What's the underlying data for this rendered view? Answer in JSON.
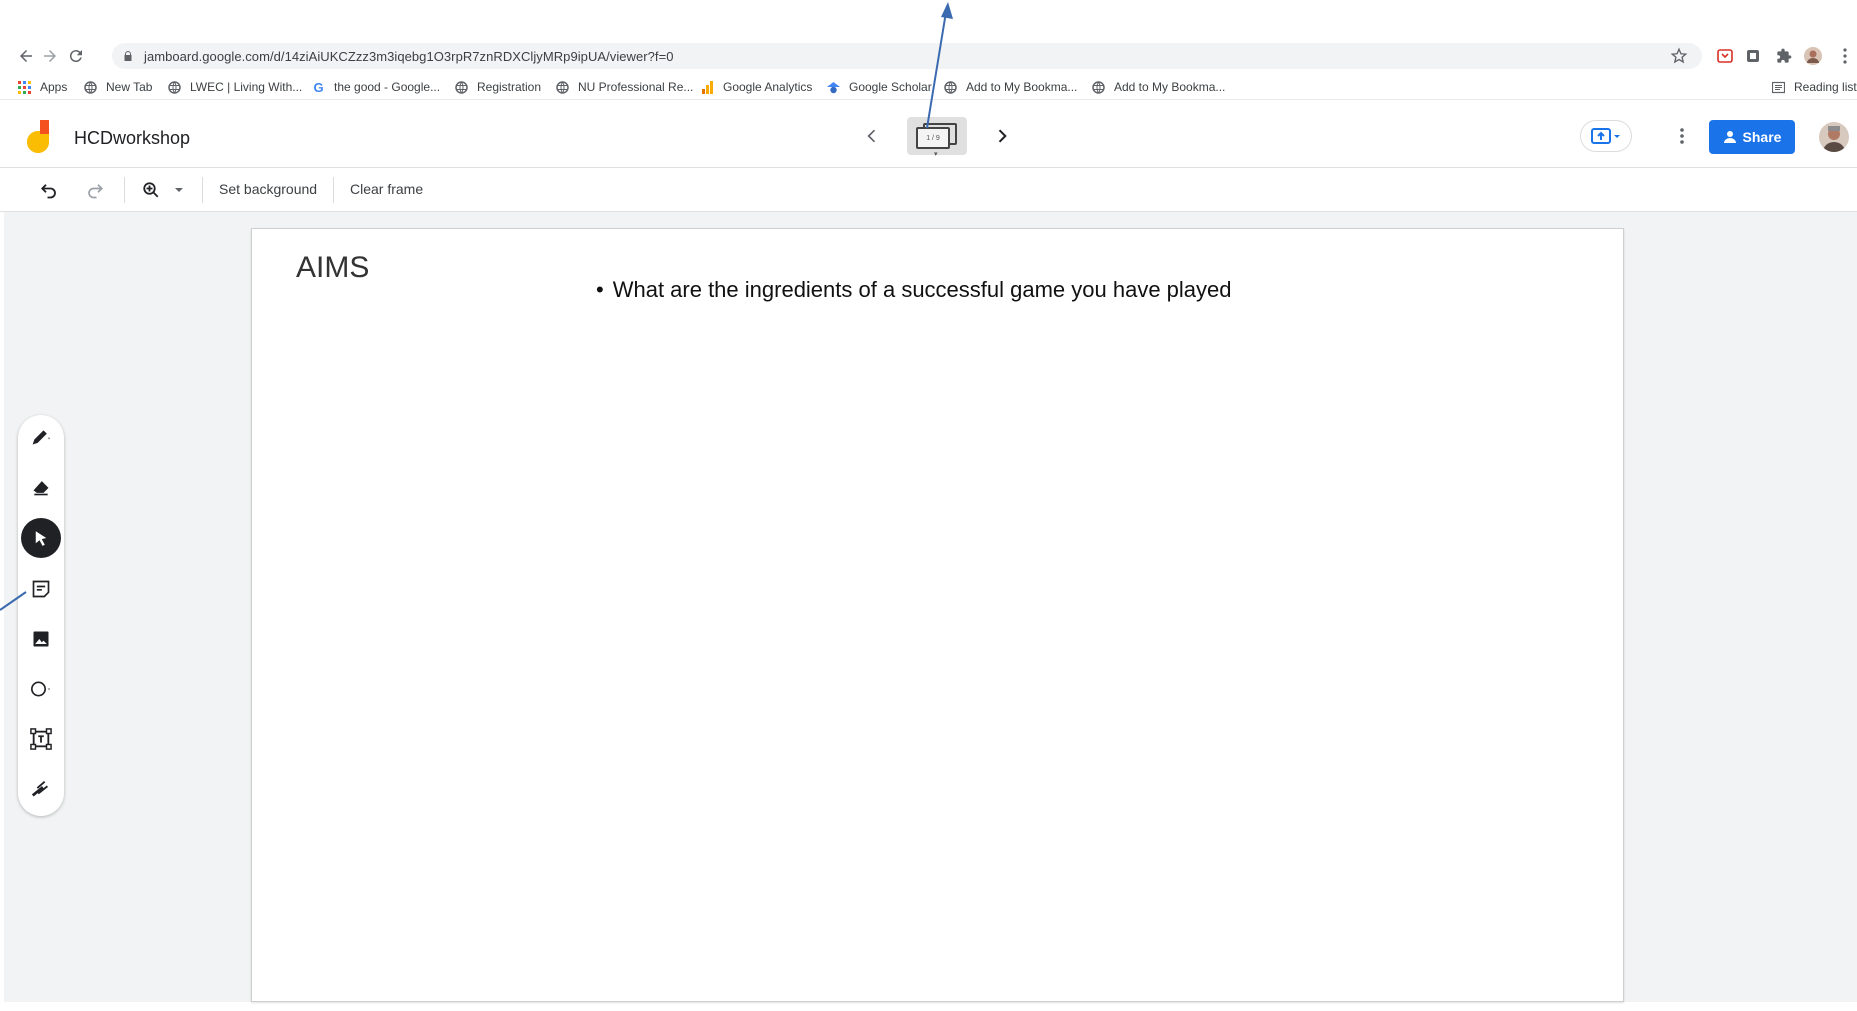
{
  "browser": {
    "url": "jamboard.google.com/d/14ziAiUKCZzz3m3iqebg1O3rpR7znRDXCljyMRp9ipUA/viewer?f=0",
    "bookmarks": [
      {
        "label": "Apps",
        "icon": "apps-grid-icon"
      },
      {
        "label": "New Tab",
        "icon": "globe-icon"
      },
      {
        "label": "LWEC | Living With...",
        "icon": "globe-icon"
      },
      {
        "label": "the good - Google...",
        "icon": "google-g-icon"
      },
      {
        "label": "Registration",
        "icon": "globe-icon"
      },
      {
        "label": "NU Professional Re...",
        "icon": "globe-icon"
      },
      {
        "label": "Google Analytics",
        "icon": "analytics-icon"
      },
      {
        "label": "Google Scholar",
        "icon": "scholar-icon"
      },
      {
        "label": "Add to My Bookma...",
        "icon": "globe-icon"
      },
      {
        "label": "Add to My Bookma...",
        "icon": "globe-icon"
      }
    ],
    "reading_list": "Reading list"
  },
  "app": {
    "title": "HCDworkshop",
    "frame_indicator": "1 / 9",
    "share_label": "Share"
  },
  "toolbar": {
    "set_background": "Set background",
    "clear_frame": "Clear frame"
  },
  "frame": {
    "heading": "AIMS",
    "bullet": "What are the ingredients of a successful game you have played"
  },
  "tools": [
    "pen-icon",
    "eraser-icon",
    "select-icon",
    "sticky-note-icon",
    "image-icon",
    "circle-icon",
    "text-box-icon",
    "laser-icon"
  ],
  "colors": {
    "share_blue": "#1a73e8",
    "annotation_arrow": "#3b6ab0",
    "canvas_bg": "#f1f3f4"
  }
}
